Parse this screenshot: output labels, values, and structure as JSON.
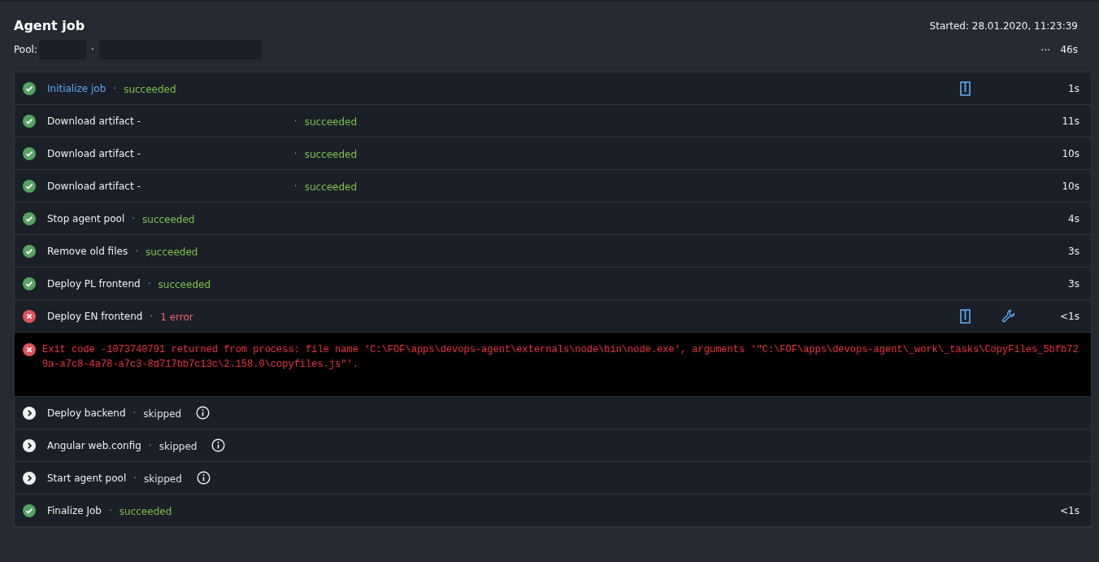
{
  "header": {
    "title": "Agent job",
    "pool_label": "Pool:",
    "pool_separator": "·",
    "started": "Started: 28.01.2020, 11:23:39",
    "more": "···",
    "duration": "46s"
  },
  "steps": [
    {
      "name": "Initialize job",
      "separator": "·",
      "status": "succeeded",
      "kind": "succeeded",
      "selected": true,
      "redacted": false,
      "attachment": true,
      "tools": false,
      "info": false,
      "duration": "1s"
    },
    {
      "name": "Download artifact -",
      "separator": "·",
      "status": "succeeded",
      "kind": "succeeded",
      "selected": false,
      "redacted": true,
      "attachment": false,
      "tools": false,
      "info": false,
      "duration": "11s"
    },
    {
      "name": "Download artifact -",
      "separator": "·",
      "status": "succeeded",
      "kind": "succeeded",
      "selected": false,
      "redacted": true,
      "attachment": false,
      "tools": false,
      "info": false,
      "duration": "10s"
    },
    {
      "name": "Download artifact -",
      "separator": "·",
      "status": "succeeded",
      "kind": "succeeded",
      "selected": false,
      "redacted": true,
      "attachment": false,
      "tools": false,
      "info": false,
      "duration": "10s"
    },
    {
      "name": "Stop agent pool",
      "separator": "·",
      "status": "succeeded",
      "kind": "succeeded",
      "selected": false,
      "redacted": false,
      "attachment": false,
      "tools": false,
      "info": false,
      "duration": "4s"
    },
    {
      "name": "Remove old files",
      "separator": "·",
      "status": "succeeded",
      "kind": "succeeded",
      "selected": false,
      "redacted": false,
      "attachment": false,
      "tools": false,
      "info": false,
      "duration": "3s"
    },
    {
      "name": "Deploy PL frontend",
      "separator": "·",
      "status": "succeeded",
      "kind": "succeeded",
      "selected": false,
      "redacted": false,
      "attachment": false,
      "tools": false,
      "info": false,
      "duration": "3s"
    },
    {
      "name": "Deploy EN frontend",
      "separator": "·",
      "status": "1 error",
      "kind": "failed",
      "selected": false,
      "redacted": false,
      "attachment": true,
      "tools": true,
      "info": false,
      "duration": "<1s",
      "error": "Exit code -1073740791 returned from process: file name 'C:\\FOF\\apps\\devops-agent\\externals\\node\\bin\\node.exe', arguments '\"C:\\FOF\\apps\\devops-agent\\_work\\_tasks\\CopyFiles_5bfb729a-a7c8-4a78-a7c3-8d717bb7c13c\\2.158.0\\copyfiles.js\"'."
    },
    {
      "name": "Deploy backend",
      "separator": "·",
      "status": "skipped",
      "kind": "skipped",
      "selected": false,
      "redacted": false,
      "attachment": false,
      "tools": false,
      "info": true
    },
    {
      "name": "Angular web.config",
      "separator": "·",
      "status": "skipped",
      "kind": "skipped",
      "selected": false,
      "redacted": false,
      "attachment": false,
      "tools": false,
      "info": true
    },
    {
      "name": "Start agent pool",
      "separator": "·",
      "status": "skipped",
      "kind": "skipped",
      "selected": false,
      "redacted": false,
      "attachment": false,
      "tools": false,
      "info": true
    },
    {
      "name": "Finalize Job",
      "separator": "·",
      "status": "succeeded",
      "kind": "succeeded",
      "selected": false,
      "redacted": false,
      "attachment": false,
      "tools": false,
      "info": false,
      "duration": "<1s"
    }
  ]
}
